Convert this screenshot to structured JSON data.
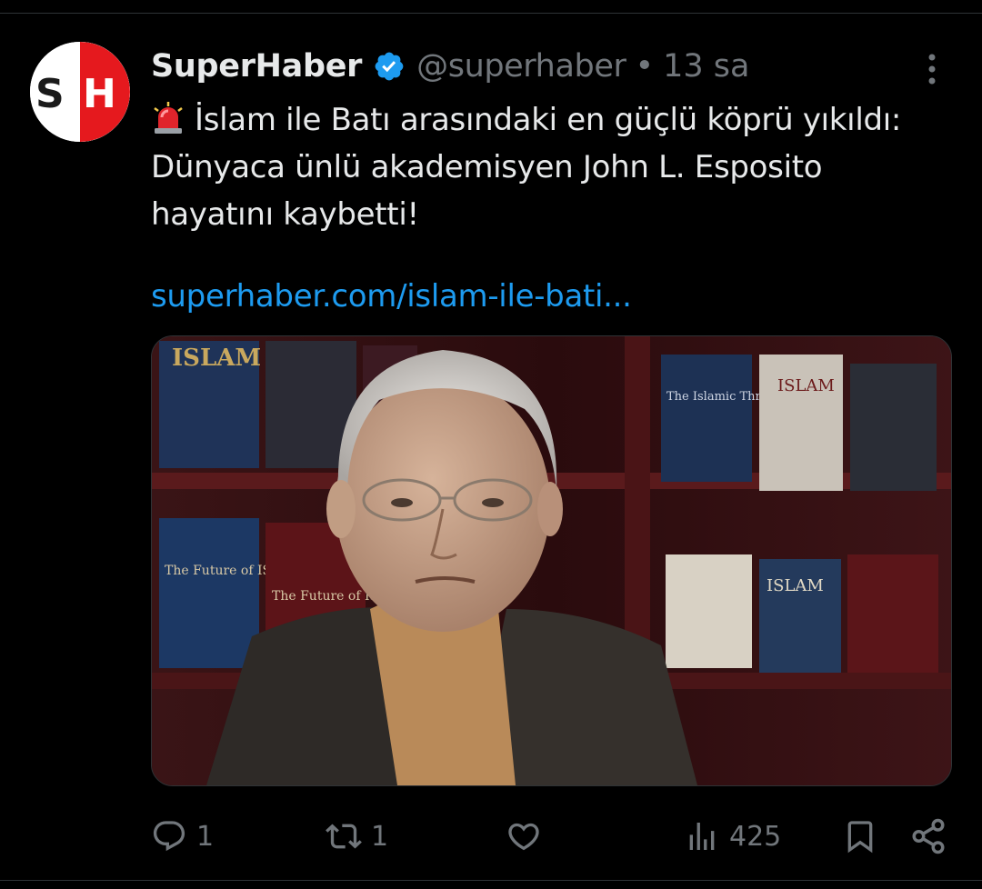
{
  "account": {
    "display_name": "SuperHaber",
    "handle": "@superhaber",
    "separator": "•",
    "time": "13 sa",
    "verified": true,
    "avatar_logo_text": "SH",
    "avatar_colors": {
      "brand_red": "#e5191e",
      "dark": "#1a1a1a"
    }
  },
  "tweet": {
    "emoji_icon": "police-light-icon",
    "text": "İslam ile Batı arasındaki en güçlü köprü yıkıldı: Dünyaca ünlü akademisyen John L. Esposito hayatını kaybetti!",
    "link_text": "superhaber.com/islam-ile-bati..."
  },
  "media": {
    "type": "photo",
    "book_spine_texts": [
      "ISLAM",
      "The Future of ISLAM",
      "The Future of ISLAM",
      "The Islamic Threat",
      "ISLAM",
      "ISLAM"
    ]
  },
  "actions": {
    "reply": {
      "icon": "reply-icon",
      "count": "1"
    },
    "retweet": {
      "icon": "retweet-icon",
      "count": "1"
    },
    "like": {
      "icon": "heart-icon"
    },
    "views": {
      "icon": "views-icon",
      "count": "425"
    },
    "bookmark": {
      "icon": "bookmark-icon"
    },
    "share": {
      "icon": "share-icon"
    }
  },
  "colors": {
    "background": "#000000",
    "text_primary": "#e7e9ea",
    "text_secondary": "#71767b",
    "link": "#1d9bf0",
    "verified_badge": "#1d9bf0",
    "divider": "#2f3336"
  }
}
